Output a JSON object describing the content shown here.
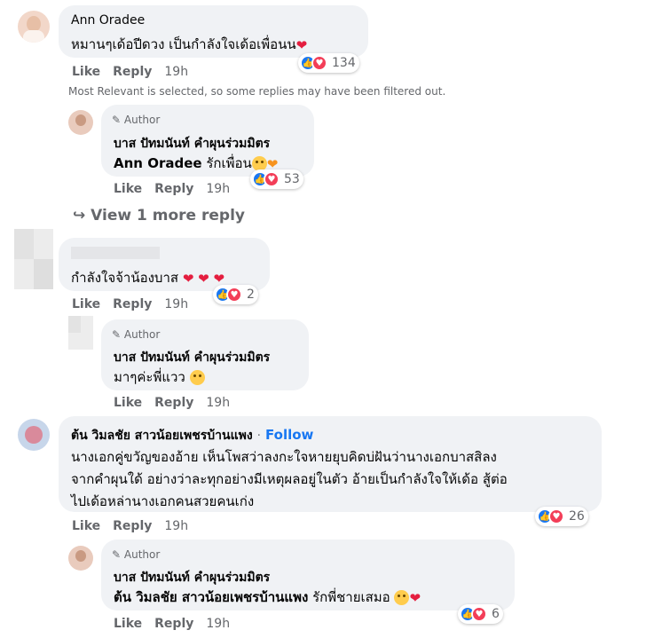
{
  "filter_notice": "Most Relevant is selected, so some replies may have been filtered out.",
  "view_more": "View 1 more reply",
  "actions": {
    "like": "Like",
    "reply": "Reply",
    "time": "19h"
  },
  "author_badge": "Author",
  "follow_label": "Follow",
  "comments": [
    {
      "name": "Ann Oradee",
      "text": "หมานๆเด้อปีดวง เป็นกำลังใจเด้อเพื่อนน",
      "reactions": "134"
    },
    {
      "name": "บาส ปัทมนันท์ คำผุนร่วมมิตร",
      "tag": "Ann Oradee",
      "text": "รักเพื่อน",
      "reactions": "53"
    },
    {
      "name": "",
      "text": "กำลังใจจ้าน้องบาส",
      "reactions": "2"
    },
    {
      "name": "บาส ปัทมนันท์ คำผุนร่วมมิตร",
      "text": "มาๆค่ะพี่แวว"
    },
    {
      "name": "ต้น วิมลชัย สาวน้อยเพชรบ้านแพง",
      "text_lines": [
        "นางเอกคู่ขวัญของอ้าย เห็นโพสว่าลงกะใจหายยุบคิดบ่ฝันว่านางเอกบาสสิลง",
        "จากคำผุนใด้ อย่างว่าละทุกอย่างมีเหตุผลอยู่ในตัว อ้ายเป็นกำลังใจให้เด้อ สู้ต่อ",
        "ไปเด้อหล่านางเอกคนสวยคนเก่ง"
      ],
      "reactions": "26"
    },
    {
      "name": "บาส ปัทมนันท์ คำผุนร่วมมิตร",
      "tag": "ต้น วิมลชัย สาวน้อยเพชรบ้านแพง",
      "text": "รักพี่ชายเสมอ",
      "reactions": "6"
    }
  ],
  "colors": {
    "bubble": "#f0f2f5",
    "like": "#1877f2",
    "love": "#f33e58",
    "meta": "#65676b",
    "follow": "#1877f2"
  }
}
